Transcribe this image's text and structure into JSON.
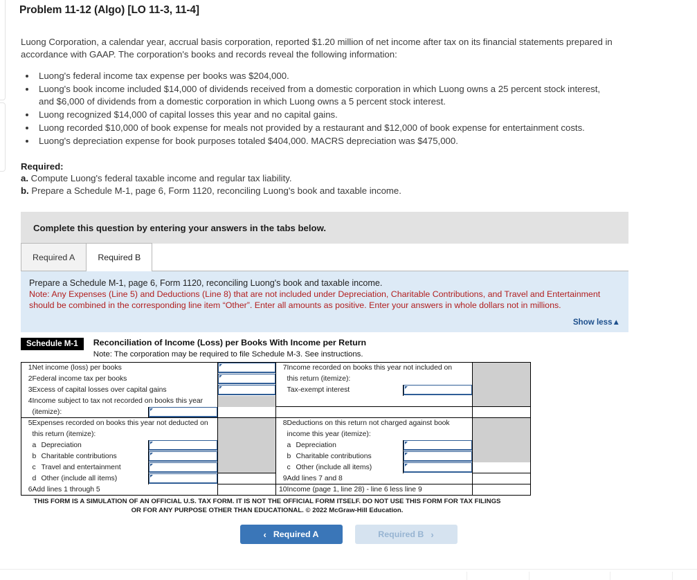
{
  "problem": {
    "title": "Problem 11-12 (Algo) [LO 11-3, 11-4]",
    "intro": "Luong Corporation, a calendar year, accrual basis corporation, reported $1.20 million of net income after tax on its financial statements prepared in accordance with GAAP. The corporation's books and records reveal the following information:",
    "facts": [
      "Luong's federal income tax expense per books was $204,000.",
      "Luong's book income included $14,000 of dividends received from a domestic corporation in which Luong owns a 25 percent stock interest, and $6,000 of dividends from a domestic corporation in which Luong owns a 5 percent stock interest.",
      "Luong recognized $14,000 of capital losses this year and no capital gains.",
      "Luong recorded $10,000 of book expense for meals not provided by a restaurant and $12,000 of book expense for entertainment costs.",
      "Luong's depreciation expense for book purposes totaled $404,000. MACRS depreciation was $475,000."
    ],
    "required_label": "Required:",
    "requirements": [
      {
        "letter": "a.",
        "text": "Compute Luong's federal taxable income and regular tax liability."
      },
      {
        "letter": "b.",
        "text": "Prepare a Schedule M-1, page 6, Form 1120, reconciling Luong's book and taxable income."
      }
    ]
  },
  "banner": {
    "text": "Complete this question by entering your answers in the tabs below."
  },
  "tabs": [
    {
      "label": "Required A",
      "active": false
    },
    {
      "label": "Required B",
      "active": true
    }
  ],
  "note": {
    "prompt": "Prepare a Schedule M-1, page 6, Form 1120, reconciling Luong's book and taxable income.",
    "warning": "Note: Any Expenses (Line 5) and Deductions (Line 8) that are not included under Depreciation, Charitable Contributions, and Travel and Entertainment should be combined in the corresponding line item “Other”. Enter all amounts as positive. Enter your answers in whole dollars not in millions.",
    "show_less": "Show less",
    "show_less_caret": "▲"
  },
  "schedule": {
    "tag": "Schedule M-1",
    "title": "Reconciliation of Income (Loss) per Books With Income per Return",
    "subtitle": "Note: The corporation may be required to file Schedule M-3. See instructions.",
    "left": {
      "line1": {
        "num": "1",
        "label": "Net income (loss) per books",
        "value": ""
      },
      "line2": {
        "num": "2",
        "label": "Federal income tax per books",
        "value": ""
      },
      "line3": {
        "num": "3",
        "label": "Excess of capital losses over capital gains",
        "value": ""
      },
      "line4": {
        "num": "4",
        "label": "Income subject to tax not recorded on books this year",
        "label2": "(itemize):",
        "value": ""
      },
      "line5": {
        "num": "5",
        "label": "Expenses recorded on books this year not deducted on",
        "label2": "this return (itemize):",
        "items": [
          {
            "letter": "a",
            "label": "Depreciation",
            "value": ""
          },
          {
            "letter": "b",
            "label": "Charitable contributions",
            "value": ""
          },
          {
            "letter": "c",
            "label": "Travel and entertainment",
            "value": ""
          },
          {
            "letter": "d",
            "label": "Other (include all items)",
            "value": ""
          }
        ]
      },
      "line6": {
        "num": "6",
        "label": "Add lines 1 through 5",
        "value": ""
      }
    },
    "right": {
      "line7": {
        "num": "7",
        "label": "Income recorded on books this year not included on",
        "label2": "this return (itemize):",
        "items": [
          {
            "letter": "",
            "label": "Tax-exempt interest",
            "value": ""
          }
        ]
      },
      "line8": {
        "num": "8",
        "label": "Deductions on this return not charged against book",
        "label2": "income this year (itemize):",
        "items": [
          {
            "letter": "a",
            "label": "Depreciation",
            "value": ""
          },
          {
            "letter": "b",
            "label": "Charitable contributions",
            "value": ""
          },
          {
            "letter": "c",
            "label": "Other (include all items)",
            "value": ""
          }
        ]
      },
      "line9": {
        "num": "9",
        "label": "Add lines 7 and 8",
        "value": ""
      },
      "line10": {
        "num": "10",
        "label": "Income (page 1, line 28) - line 6 less line 9",
        "value": ""
      }
    }
  },
  "disclaimer": {
    "line1": "THIS FORM IS A SIMULATION OF AN OFFICIAL U.S. TAX FORM. IT IS NOT THE OFFICIAL FORM ITSELF. DO NOT USE THIS FORM FOR TAX FILINGS",
    "line2": "OR FOR ANY PURPOSE OTHER THAN EDUCATIONAL. © 2022 McGraw-Hill Education."
  },
  "nav": {
    "prev_label": "Required A",
    "prev_icon": "‹",
    "next_label": "Required B",
    "next_icon": "›"
  },
  "colors": {
    "accent_blue": "#3a76b8",
    "note_bg": "#ddeaf6",
    "note_red": "#b11e1e",
    "banner_grey": "#e2e2e2",
    "field_border": "#2f5d96",
    "shaded_cell": "#cfcfcf"
  }
}
